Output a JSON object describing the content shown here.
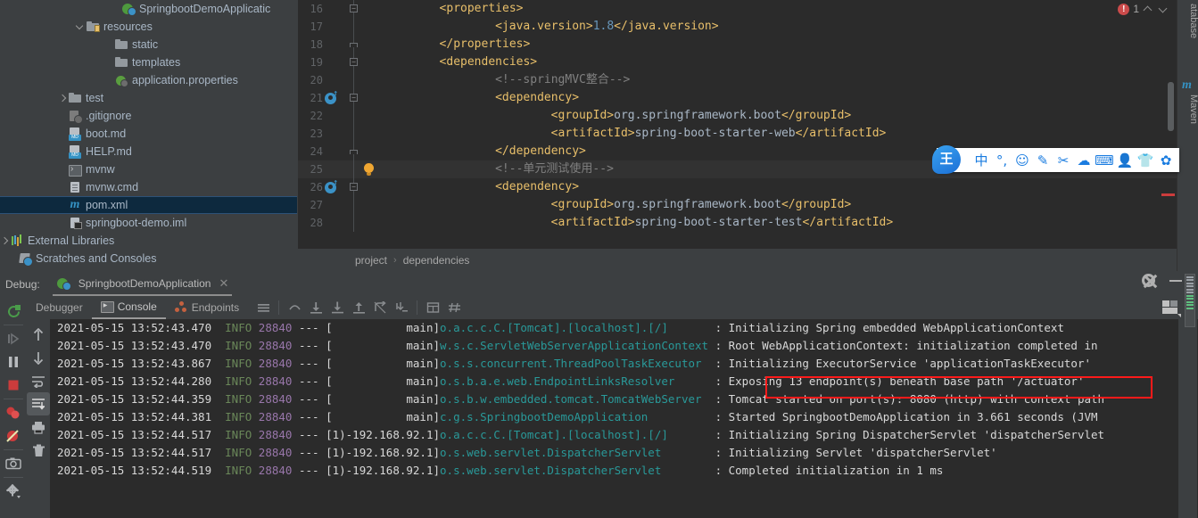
{
  "project_tree": {
    "items": [
      {
        "label": "SpringbootDemoApplicatic",
        "indent": 136,
        "icon": "bootclass-icon",
        "arrow": "none",
        "selected": false
      },
      {
        "label": "resources",
        "indent": 96,
        "icon": "folder-resources-icon",
        "arrow": "down",
        "selected": false
      },
      {
        "label": "static",
        "indent": 128,
        "icon": "folder-icon",
        "arrow": "none",
        "selected": false
      },
      {
        "label": "templates",
        "indent": 128,
        "icon": "folder-icon",
        "arrow": "none",
        "selected": false
      },
      {
        "label": "application.properties",
        "indent": 128,
        "icon": "spring-properties-icon",
        "arrow": "none",
        "selected": false
      },
      {
        "label": "test",
        "indent": 76,
        "icon": "folder-icon",
        "arrow": "right",
        "selected": false
      },
      {
        "label": ".gitignore",
        "indent": 76,
        "icon": "gitignore-icon",
        "arrow": "none",
        "selected": false
      },
      {
        "label": "boot.md",
        "indent": 76,
        "icon": "markdown-icon",
        "arrow": "none",
        "selected": false
      },
      {
        "label": "HELP.md",
        "indent": 76,
        "icon": "markdown-icon",
        "arrow": "none",
        "selected": false
      },
      {
        "label": "mvnw",
        "indent": 76,
        "icon": "executable-icon",
        "arrow": "none",
        "selected": false
      },
      {
        "label": "mvnw.cmd",
        "indent": 76,
        "icon": "file-icon",
        "arrow": "none",
        "selected": false
      },
      {
        "label": "pom.xml",
        "indent": 76,
        "icon": "maven-icon",
        "arrow": "none",
        "selected": true
      },
      {
        "label": "springboot-demo.iml",
        "indent": 76,
        "icon": "iml-icon",
        "arrow": "none",
        "selected": false
      },
      {
        "label": "External Libraries",
        "indent": 8,
        "icon": "libraries-icon",
        "arrow": "right",
        "selected": false
      },
      {
        "label": "Scratches and Consoles",
        "indent": 20,
        "icon": "scratches-icon",
        "arrow": "none",
        "selected": false
      }
    ]
  },
  "editor": {
    "lines": [
      {
        "num": "16",
        "indent": 8,
        "fold": "minus",
        "bean": false,
        "bulb": false,
        "parts": [
          {
            "t": "tag",
            "v": "<properties>"
          }
        ]
      },
      {
        "num": "17",
        "indent": 16,
        "fold": "",
        "bean": false,
        "bulb": false,
        "parts": [
          {
            "t": "tag",
            "v": "<java.version>"
          },
          {
            "t": "num",
            "v": "1.8"
          },
          {
            "t": "tag",
            "v": "</java.version>"
          }
        ]
      },
      {
        "num": "18",
        "indent": 8,
        "fold": "end",
        "bean": false,
        "bulb": false,
        "parts": [
          {
            "t": "tag",
            "v": "</properties>"
          }
        ]
      },
      {
        "num": "19",
        "indent": 8,
        "fold": "minus",
        "bean": false,
        "bulb": false,
        "parts": [
          {
            "t": "tag",
            "v": "<dependencies>"
          }
        ]
      },
      {
        "num": "20",
        "indent": 16,
        "fold": "",
        "bean": false,
        "bulb": false,
        "parts": [
          {
            "t": "cmt",
            "v": "<!--springMVC整合-->"
          }
        ]
      },
      {
        "num": "21",
        "indent": 16,
        "fold": "minus",
        "bean": true,
        "bulb": false,
        "parts": [
          {
            "t": "tag",
            "v": "<dependency>"
          }
        ]
      },
      {
        "num": "22",
        "indent": 24,
        "fold": "",
        "bean": false,
        "bulb": false,
        "parts": [
          {
            "t": "tag",
            "v": "<groupId>"
          },
          {
            "t": "txt",
            "v": "org.springframework.boot"
          },
          {
            "t": "tag",
            "v": "</groupId>"
          }
        ]
      },
      {
        "num": "23",
        "indent": 24,
        "fold": "",
        "bean": false,
        "bulb": false,
        "parts": [
          {
            "t": "tag",
            "v": "<artifactId>"
          },
          {
            "t": "txt",
            "v": "spring-boot-starter-web"
          },
          {
            "t": "tag",
            "v": "</artifactId>"
          }
        ]
      },
      {
        "num": "24",
        "indent": 16,
        "fold": "end",
        "bean": false,
        "bulb": false,
        "parts": [
          {
            "t": "tag",
            "v": "</dependency>"
          }
        ]
      },
      {
        "num": "25",
        "indent": 16,
        "fold": "",
        "bean": false,
        "bulb": true,
        "highlight": true,
        "parts": [
          {
            "t": "cmt",
            "v": "<!--单元测试使用-->"
          }
        ]
      },
      {
        "num": "26",
        "indent": 16,
        "fold": "minus",
        "bean": true,
        "bulb": false,
        "parts": [
          {
            "t": "tag",
            "v": "<dependency>"
          }
        ]
      },
      {
        "num": "27",
        "indent": 24,
        "fold": "",
        "bean": false,
        "bulb": false,
        "parts": [
          {
            "t": "tag",
            "v": "<groupId>"
          },
          {
            "t": "txt",
            "v": "org.springframework.boot"
          },
          {
            "t": "tag",
            "v": "</groupId>"
          }
        ]
      },
      {
        "num": "28",
        "indent": 24,
        "fold": "",
        "bean": false,
        "bulb": false,
        "parts": [
          {
            "t": "tag",
            "v": "<artifactId>"
          },
          {
            "t": "txt",
            "v": "spring-boot-starter-test"
          },
          {
            "t": "tag",
            "v": "</artifactId>"
          }
        ]
      }
    ],
    "breadcrumb": [
      "project",
      "dependencies"
    ],
    "breadcrumb_separator": "›",
    "error_count": "1",
    "error_glyph": "!"
  },
  "right_tool_window": {
    "tabs": [
      {
        "label": "atabase"
      },
      {
        "label": "Maven",
        "icon": "maven-icon",
        "icon_glyph": "m"
      }
    ]
  },
  "ime_toolbar": {
    "logo": "王",
    "icons": [
      {
        "name": "chinese-mode-icon",
        "glyph": "中",
        "grey": false
      },
      {
        "name": "punctuation-icon",
        "glyph": "°,",
        "grey": false
      },
      {
        "name": "emoji-icon",
        "glyph": "☺",
        "grey": false
      },
      {
        "name": "handwriting-icon",
        "glyph": "✎",
        "grey": false
      },
      {
        "name": "scissors-icon",
        "glyph": "✂",
        "grey": false
      },
      {
        "name": "cloud-icon",
        "glyph": "☁",
        "grey": false
      },
      {
        "name": "keyboard-icon",
        "glyph": "⌨",
        "grey": false
      },
      {
        "name": "user-icon",
        "glyph": "👤",
        "grey": true
      },
      {
        "name": "skin-icon",
        "glyph": "👕",
        "grey": false
      },
      {
        "name": "settings-icon",
        "glyph": "✿",
        "grey": false
      }
    ]
  },
  "debug_panel": {
    "title": "Debug:",
    "run_config": "SpringbootDemoApplication",
    "close_label": "✕",
    "tabs": [
      {
        "label": "Debugger",
        "icon": null,
        "active": false
      },
      {
        "label": "Console",
        "icon": "console-icon",
        "active": true
      },
      {
        "label": "Endpoints",
        "icon": "endpoints-icon",
        "active": false
      }
    ],
    "left_toolbar": [
      {
        "name": "rerun-button",
        "glyph": "⟳",
        "color": "#4a9c4a"
      },
      {
        "name": "resume-button",
        "glyph": "▶|",
        "color": "#8a8d90"
      },
      {
        "name": "pause-button",
        "glyph": "❚❚",
        "color": "#b0b3b6"
      },
      {
        "name": "stop-button",
        "glyph": "■",
        "color": "#cc3c3c"
      },
      {
        "name": "view-breakpoints-button",
        "glyph": "●●",
        "color": "#cc3c3c"
      },
      {
        "name": "mute-breakpoints-button",
        "glyph": "⊘",
        "color": "#cc3c3c"
      },
      {
        "name": "screenshot-button",
        "glyph": "▣",
        "color": "#b0b3b6"
      },
      {
        "name": "settings-button",
        "glyph": "⚙",
        "color": "#b0b3b6"
      }
    ],
    "console_side_toolbar": [
      {
        "name": "scroll-up-button",
        "glyph": "↑"
      },
      {
        "name": "scroll-down-button",
        "glyph": "↓"
      },
      {
        "name": "soft-wrap-button",
        "glyph": "⇥"
      },
      {
        "name": "scroll-to-end-button",
        "glyph": "⤓",
        "active": true
      },
      {
        "name": "print-button",
        "glyph": "🖶"
      },
      {
        "name": "clear-all-button",
        "glyph": "🗑"
      }
    ],
    "step_toolbar": [
      {
        "name": "show-execution-point-button",
        "glyph": "≡"
      },
      {
        "name": "step-over-button",
        "glyph": "⌒"
      },
      {
        "name": "step-into-button",
        "glyph": "↓"
      },
      {
        "name": "force-step-into-button",
        "glyph": "↡"
      },
      {
        "name": "step-out-button",
        "glyph": "↑"
      },
      {
        "name": "drop-frame-button",
        "glyph": "↷"
      },
      {
        "name": "run-to-cursor-button",
        "glyph": "⇲"
      },
      {
        "name": "evaluate-expression-button",
        "glyph": "▦"
      },
      {
        "name": "settings2-button",
        "glyph": "⌗"
      }
    ],
    "gear_tooltip": "Settings",
    "minimize_tooltip": "Hide"
  },
  "console_log": {
    "lines": [
      {
        "ts": "2021-05-15 13:52:43.470",
        "level": "INFO",
        "pid": "28840",
        "sep": " --- [",
        "thread": "           main]",
        "logger": "o.a.c.c.C.[Tomcat].[localhost].[/]       ",
        "msg": ": Initializing Spring embedded WebApplicationContext",
        "highlighted": false
      },
      {
        "ts": "2021-05-15 13:52:43.470",
        "level": "INFO",
        "pid": "28840",
        "sep": " --- [",
        "thread": "           main]",
        "logger": "w.s.c.ServletWebServerApplicationContext ",
        "msg": ": Root WebApplicationContext: initialization completed in",
        "highlighted": false
      },
      {
        "ts": "2021-05-15 13:52:43.867",
        "level": "INFO",
        "pid": "28840",
        "sep": " --- [",
        "thread": "           main]",
        "logger": "o.s.s.concurrent.ThreadPoolTaskExecutor  ",
        "msg": ": Initializing ExecutorService 'applicationTaskExecutor'",
        "highlighted": false
      },
      {
        "ts": "2021-05-15 13:52:44.280",
        "level": "INFO",
        "pid": "28840",
        "sep": " --- [",
        "thread": "           main]",
        "logger": "o.s.b.a.e.web.EndpointLinksResolver      ",
        "msg": ": Exposing 13 endpoint(s) beneath base path '/actuator'",
        "highlighted": true
      },
      {
        "ts": "2021-05-15 13:52:44.359",
        "level": "INFO",
        "pid": "28840",
        "sep": " --- [",
        "thread": "           main]",
        "logger": "o.s.b.w.embedded.tomcat.TomcatWebServer  ",
        "msg": ": Tomcat started on port(s): 8080 (http) with context path",
        "highlighted": false
      },
      {
        "ts": "2021-05-15 13:52:44.381",
        "level": "INFO",
        "pid": "28840",
        "sep": " --- [",
        "thread": "           main]",
        "logger": "c.g.s.SpringbootDemoApplication          ",
        "msg": ": Started SpringbootDemoApplication in 3.661 seconds (JVM",
        "highlighted": false
      },
      {
        "ts": "2021-05-15 13:52:44.517",
        "level": "INFO",
        "pid": "28840",
        "sep": " --- [",
        "thread": "1)-192.168.92.1]",
        "logger": "o.a.c.c.C.[Tomcat].[localhost].[/]       ",
        "msg": ": Initializing Spring DispatcherServlet 'dispatcherServlet",
        "highlighted": false
      },
      {
        "ts": "2021-05-15 13:52:44.517",
        "level": "INFO",
        "pid": "28840",
        "sep": " --- [",
        "thread": "1)-192.168.92.1]",
        "logger": "o.s.web.servlet.DispatcherServlet        ",
        "msg": ": Initializing Servlet 'dispatcherServlet'",
        "highlighted": false
      },
      {
        "ts": "2021-05-15 13:52:44.519",
        "level": "INFO",
        "pid": "28840",
        "sep": " --- [",
        "thread": "1)-192.168.92.1]",
        "logger": "o.s.web.servlet.DispatcherServlet        ",
        "msg": ": Completed initialization in 1 ms",
        "highlighted": false
      }
    ],
    "highlight_color": "#ff1a1a"
  },
  "colors": {
    "ide_background": "#3c3f41",
    "editor_background": "#2b2b2b",
    "selection_blue": "#0d293e",
    "tag_orange": "#e8bf6a",
    "logger_teal": "#299999",
    "info_green": "#6a8759",
    "pid_purple": "#9876aa",
    "error_red": "#cc3c3c"
  }
}
